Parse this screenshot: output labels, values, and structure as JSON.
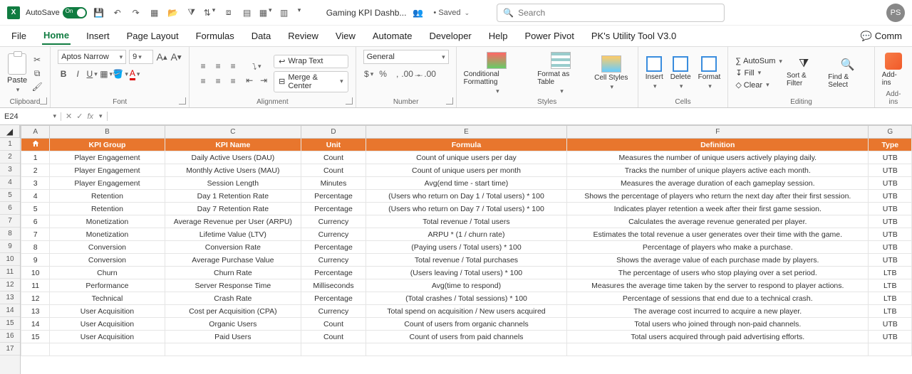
{
  "titlebar": {
    "autosave_label": "AutoSave",
    "autosave_state": "On",
    "doc_title": "Gaming KPI Dashb...",
    "saved_text": "• Saved",
    "search_placeholder": "Search",
    "avatar_initials": "PS"
  },
  "tabs": {
    "items": [
      "File",
      "Home",
      "Insert",
      "Page Layout",
      "Formulas",
      "Data",
      "Review",
      "View",
      "Automate",
      "Developer",
      "Help",
      "Power Pivot",
      "PK's Utility Tool V3.0"
    ],
    "active": "Home",
    "comments_label": "Comm"
  },
  "ribbon": {
    "clipboard": {
      "label": "Clipboard",
      "paste": "Paste"
    },
    "font": {
      "label": "Font",
      "name": "Aptos Narrow",
      "size": "9"
    },
    "alignment": {
      "label": "Alignment",
      "wrap": "Wrap Text",
      "merge": "Merge & Center"
    },
    "number": {
      "label": "Number",
      "format": "General"
    },
    "styles": {
      "label": "Styles",
      "cond": "Conditional Formatting",
      "table": "Format as Table",
      "cell": "Cell Styles"
    },
    "cells": {
      "label": "Cells",
      "insert": "Insert",
      "delete": "Delete",
      "format": "Format"
    },
    "editing": {
      "label": "Editing",
      "autosum": "AutoSum",
      "fill": "Fill",
      "clear": "Clear",
      "sort": "Sort & Filter",
      "find": "Find & Select"
    },
    "addins": {
      "label": "Add-ins",
      "btn": "Add-ins"
    }
  },
  "formula_bar": {
    "cell_ref": "E24",
    "fx": "fx"
  },
  "grid": {
    "col_letters": [
      "A",
      "B",
      "C",
      "D",
      "E",
      "F",
      "G"
    ],
    "row_numbers": [
      "1",
      "2",
      "3",
      "4",
      "5",
      "6",
      "7",
      "8",
      "9",
      "10",
      "11",
      "12",
      "13",
      "14",
      "15",
      "16",
      "17"
    ],
    "header_row": {
      "A": "#",
      "B": "KPI Group",
      "C": "KPI Name",
      "D": "Unit",
      "E": "Formula",
      "F": "Definition",
      "G": "Type"
    },
    "rows": [
      {
        "n": "1",
        "group": "Player Engagement",
        "name": "Daily Active Users (DAU)",
        "unit": "Count",
        "formula": "Count of unique users per day",
        "def": "Measures the number of unique users actively playing daily.",
        "type": "UTB"
      },
      {
        "n": "2",
        "group": "Player Engagement",
        "name": "Monthly Active Users (MAU)",
        "unit": "Count",
        "formula": "Count of unique users per month",
        "def": "Tracks the number of unique players active each month.",
        "type": "UTB"
      },
      {
        "n": "3",
        "group": "Player Engagement",
        "name": "Session Length",
        "unit": "Minutes",
        "formula": "Avg(end time - start time)",
        "def": "Measures the average duration of each gameplay session.",
        "type": "UTB"
      },
      {
        "n": "4",
        "group": "Retention",
        "name": "Day 1 Retention Rate",
        "unit": "Percentage",
        "formula": "(Users who return on Day 1 / Total users) * 100",
        "def": "Shows the percentage of players who return the next day after their first session.",
        "type": "UTB"
      },
      {
        "n": "5",
        "group": "Retention",
        "name": "Day 7 Retention Rate",
        "unit": "Percentage",
        "formula": "(Users who return on Day 7 / Total users) * 100",
        "def": "Indicates player retention a week after their first game session.",
        "type": "UTB"
      },
      {
        "n": "6",
        "group": "Monetization",
        "name": "Average Revenue per User (ARPU)",
        "unit": "Currency",
        "formula": "Total revenue / Total users",
        "def": "Calculates the average revenue generated per player.",
        "type": "UTB"
      },
      {
        "n": "7",
        "group": "Monetization",
        "name": "Lifetime Value (LTV)",
        "unit": "Currency",
        "formula": "ARPU * (1 / churn rate)",
        "def": "Estimates the total revenue a user generates over their time with the game.",
        "type": "UTB"
      },
      {
        "n": "8",
        "group": "Conversion",
        "name": "Conversion Rate",
        "unit": "Percentage",
        "formula": "(Paying users / Total users) * 100",
        "def": "Percentage of players who make a purchase.",
        "type": "UTB"
      },
      {
        "n": "9",
        "group": "Conversion",
        "name": "Average Purchase Value",
        "unit": "Currency",
        "formula": "Total revenue / Total purchases",
        "def": "Shows the average value of each purchase made by players.",
        "type": "UTB"
      },
      {
        "n": "10",
        "group": "Churn",
        "name": "Churn Rate",
        "unit": "Percentage",
        "formula": "(Users leaving / Total users) * 100",
        "def": "The percentage of users who stop playing over a set period.",
        "type": "LTB"
      },
      {
        "n": "11",
        "group": "Performance",
        "name": "Server Response Time",
        "unit": "Milliseconds",
        "formula": "Avg(time to respond)",
        "def": "Measures the average time taken by the server to respond to player actions.",
        "type": "LTB"
      },
      {
        "n": "12",
        "group": "Technical",
        "name": "Crash Rate",
        "unit": "Percentage",
        "formula": "(Total crashes / Total sessions) * 100",
        "def": "Percentage of sessions that end due to a technical crash.",
        "type": "LTB"
      },
      {
        "n": "13",
        "group": "User Acquisition",
        "name": "Cost per Acquisition (CPA)",
        "unit": "Currency",
        "formula": "Total spend on acquisition / New users acquired",
        "def": "The average cost incurred to acquire a new player.",
        "type": "LTB"
      },
      {
        "n": "14",
        "group": "User Acquisition",
        "name": "Organic Users",
        "unit": "Count",
        "formula": "Count of users from organic channels",
        "def": "Total users who joined through non-paid channels.",
        "type": "UTB"
      },
      {
        "n": "15",
        "group": "User Acquisition",
        "name": "Paid Users",
        "unit": "Count",
        "formula": "Count of users from paid channels",
        "def": "Total users acquired through paid advertising efforts.",
        "type": "UTB"
      }
    ]
  }
}
